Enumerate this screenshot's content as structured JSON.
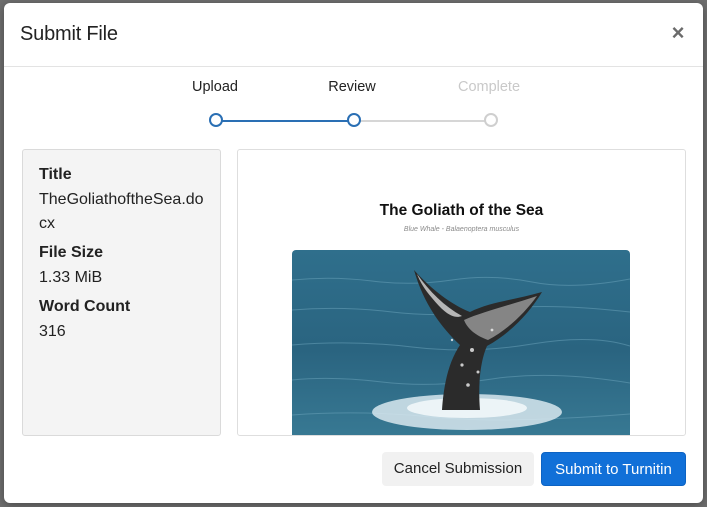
{
  "modal": {
    "title": "Submit File",
    "close_glyph": "×"
  },
  "stepper": {
    "steps": [
      {
        "label": "Upload",
        "state": "done"
      },
      {
        "label": "Review",
        "state": "current"
      },
      {
        "label": "Complete",
        "state": "pending"
      }
    ],
    "accent_color": "#2a6fb4"
  },
  "file_info": {
    "title_label": "Title",
    "title_value": "TheGoliathoftheSea.docx",
    "size_label": "File Size",
    "size_value": "1.33 MiB",
    "words_label": "Word Count",
    "words_value": "316"
  },
  "preview": {
    "doc_title": "The Goliath of the Sea",
    "doc_subtitle": "Blue Whale - Balaenoptera musculus"
  },
  "footer": {
    "cancel_label": "Cancel Submission",
    "submit_label": "Submit to Turnitin",
    "submit_color": "#1170d8"
  }
}
